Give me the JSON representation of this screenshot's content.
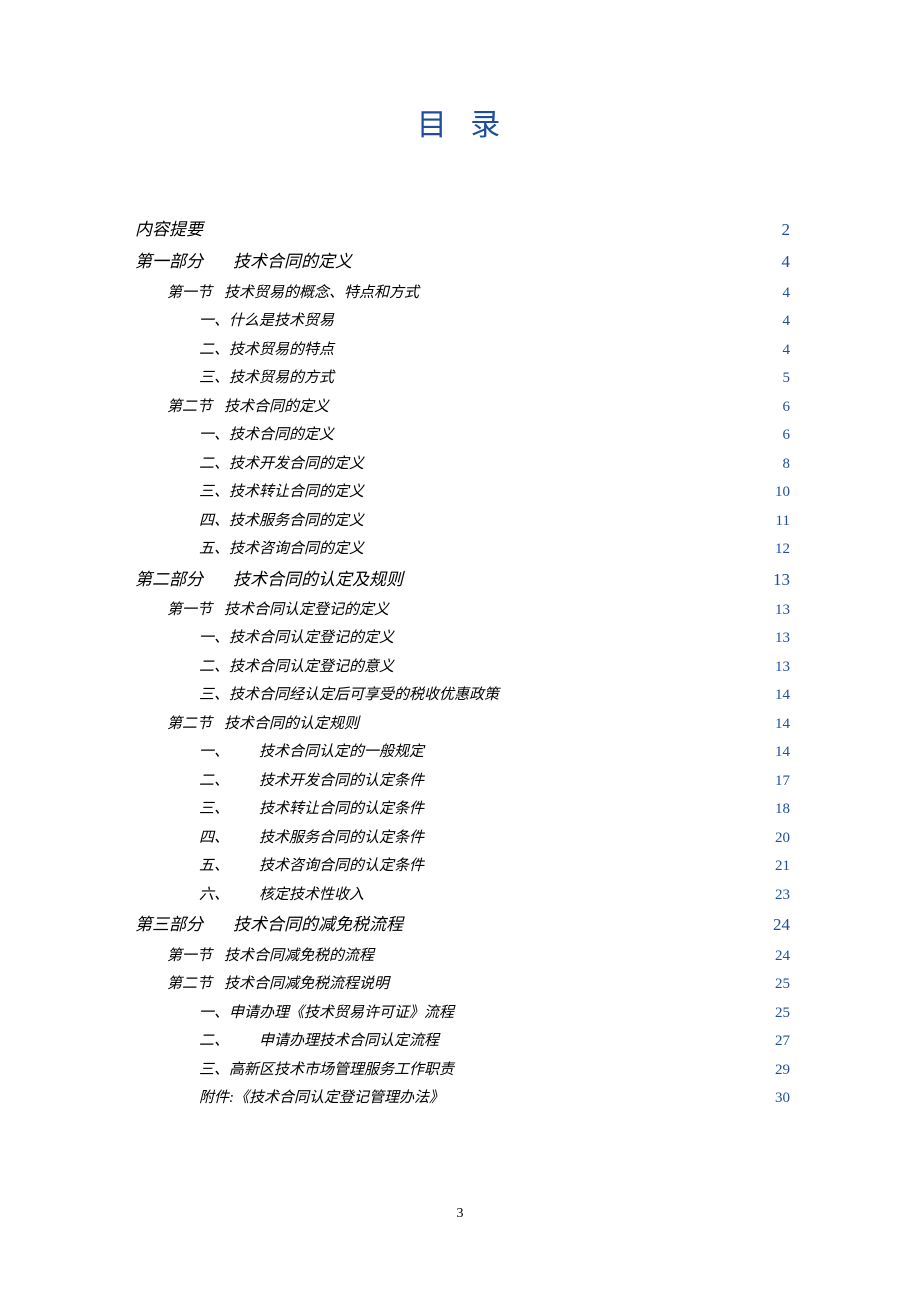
{
  "title": "目 录",
  "page_number": "3",
  "toc": [
    {
      "level": 0,
      "prefix": "",
      "label": "内容提要",
      "page": "2"
    },
    {
      "level": 0,
      "prefix": "第一部分",
      "label": "技术合同的定义",
      "page": "4"
    },
    {
      "level": 1,
      "prefix": "第一节",
      "label": "技术贸易的概念、特点和方式",
      "page": "4"
    },
    {
      "level": 2,
      "prefix": "",
      "label": "一、什么是技术贸易",
      "page": "4"
    },
    {
      "level": 2,
      "prefix": "",
      "label": "二、技术贸易的特点",
      "page": "4"
    },
    {
      "level": 2,
      "prefix": "",
      "label": "三、技术贸易的方式",
      "page": "5"
    },
    {
      "level": 1,
      "prefix": "第二节",
      "label": "技术合同的定义",
      "page": "6"
    },
    {
      "level": 2,
      "prefix": "",
      "label": "一、技术合同的定义",
      "page": "6"
    },
    {
      "level": 2,
      "prefix": "",
      "label": "二、技术开发合同的定义",
      "page": "8"
    },
    {
      "level": 2,
      "prefix": "",
      "label": "三、技术转让合同的定义",
      "page": "10"
    },
    {
      "level": 2,
      "prefix": "",
      "label": "四、技术服务合同的定义",
      "page": "11"
    },
    {
      "level": 2,
      "prefix": "",
      "label": "五、技术咨询合同的定义",
      "page": "12"
    },
    {
      "level": 0,
      "prefix": "第二部分",
      "label": "技术合同的认定及规则",
      "page": "13"
    },
    {
      "level": 1,
      "prefix": "第一节",
      "label": "技术合同认定登记的定义",
      "page": "13"
    },
    {
      "level": 2,
      "prefix": "",
      "label": "一、技术合同认定登记的定义",
      "page": "13"
    },
    {
      "level": 2,
      "prefix": "",
      "label": "二、技术合同认定登记的意义",
      "page": "13"
    },
    {
      "level": 2,
      "prefix": "",
      "label": "三、技术合同经认定后可享受的税收优惠政策",
      "page": "14"
    },
    {
      "level": 1,
      "prefix": "第二节",
      "label": "技术合同的认定规则",
      "page": "14"
    },
    {
      "level": 2,
      "prefix": "一、",
      "label": "技术合同认定的一般规定",
      "page": "14",
      "wide": true
    },
    {
      "level": 2,
      "prefix": "二、",
      "label": "技术开发合同的认定条件",
      "page": "17",
      "wide": true
    },
    {
      "level": 2,
      "prefix": "三、",
      "label": "技术转让合同的认定条件",
      "page": "18",
      "wide": true
    },
    {
      "level": 2,
      "prefix": "四、",
      "label": "技术服务合同的认定条件",
      "page": "20",
      "wide": true
    },
    {
      "level": 2,
      "prefix": "五、",
      "label": "技术咨询合同的认定条件",
      "page": "21",
      "wide": true
    },
    {
      "level": 2,
      "prefix": "六、",
      "label": "核定技术性收入",
      "page": "23",
      "wide": true
    },
    {
      "level": 0,
      "prefix": "第三部分",
      "label": "技术合同的减免税流程",
      "page": "24"
    },
    {
      "level": 1,
      "prefix": "第一节",
      "label": "技术合同减免税的流程",
      "page": "24"
    },
    {
      "level": 1,
      "prefix": "第二节",
      "label": "技术合同减免税流程说明",
      "page": "25"
    },
    {
      "level": 2,
      "prefix": "",
      "label": "一、申请办理《技术贸易许可证》流程",
      "page": "25"
    },
    {
      "level": 2,
      "prefix": "二、",
      "label": "申请办理技术合同认定流程",
      "page": "27",
      "wide": true
    },
    {
      "level": 2,
      "prefix": "",
      "label": "三、高新区技术市场管理服务工作职责",
      "page": "29"
    },
    {
      "level": 2,
      "prefix": "",
      "label": "附件:《技术合同认定登记管理办法》",
      "page": "30"
    }
  ]
}
